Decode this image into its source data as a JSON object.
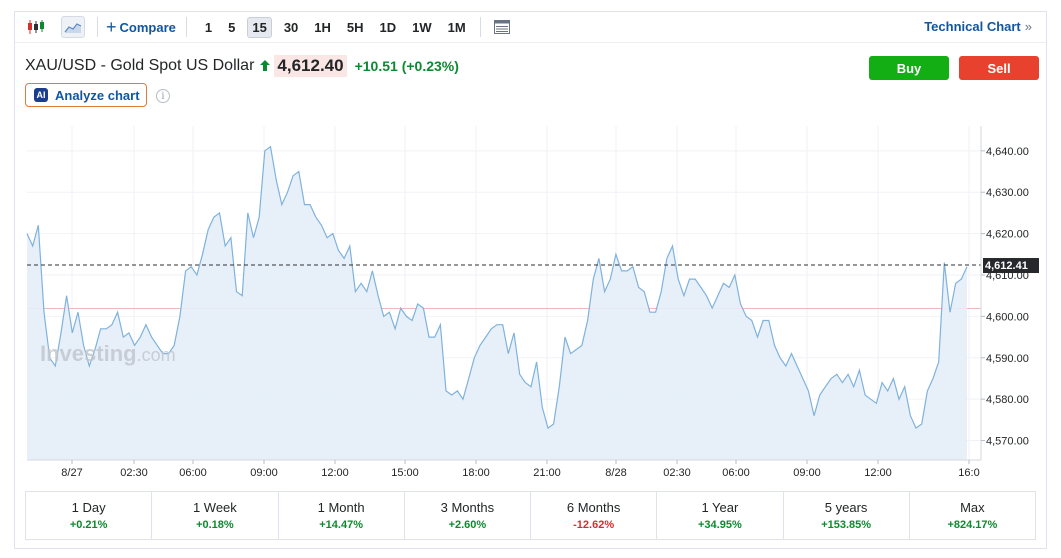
{
  "toolbar": {
    "compare_label": "Compare",
    "intervals": [
      "1",
      "5",
      "15",
      "30",
      "1H",
      "5H",
      "1D",
      "1W",
      "1M"
    ],
    "active_interval": "15",
    "technical_chart_label": "Technical Chart",
    "technical_chart_chevron": "»"
  },
  "instrument": {
    "name": "XAU/USD - Gold Spot US Dollar",
    "price": "4,612.40",
    "change": "+10.51",
    "change_pct": "(+0.23%)"
  },
  "buttons": {
    "buy": "Buy",
    "sell": "Sell"
  },
  "analyze": {
    "badge": "AI",
    "label": "Analyze chart"
  },
  "watermark": {
    "brand": "Investing",
    "suffix": ".com"
  },
  "colors": {
    "up": "#0d8a2f",
    "down": "#d32f2f",
    "buy": "#13ae13",
    "sell": "#e8412d",
    "line": "#7fb2dc",
    "area": "#e4eef7",
    "ref_line": "#f2b8b8"
  },
  "chart_data": {
    "type": "area",
    "x_tick_labels": [
      "8/27",
      "02:30",
      "06:00",
      "09:00",
      "12:00",
      "15:00",
      "18:00",
      "21:00",
      "8/28",
      "02:30",
      "06:00",
      "09:00",
      "12:00",
      "16:0"
    ],
    "y_tick_labels": [
      "4,640.00",
      "4,630.00",
      "4,620.00",
      "4,610.00",
      "4,600.00",
      "4,590.00",
      "4,580.00",
      "4,570.00"
    ],
    "y_ticks": [
      4640,
      4630,
      4620,
      4610,
      4600,
      4590,
      4580,
      4570
    ],
    "ylim": [
      4565.3,
      4646
    ],
    "last_price_label": "4,612.41",
    "last_price": 4612.41,
    "reference_price": 4601.9,
    "values": [
      4620.0,
      4617.0,
      4622.0,
      4601.0,
      4590.0,
      4588.0,
      4596.0,
      4605.0,
      4596.0,
      4601.0,
      4593.0,
      4588.0,
      4592.0,
      4597.0,
      4597.0,
      4598.0,
      4601.0,
      4595.0,
      4596.0,
      4593.0,
      4595.0,
      4598.0,
      4595.0,
      4593.0,
      4591.0,
      4591.0,
      4593.0,
      4600.0,
      4611.0,
      4612.0,
      4610.0,
      4615.0,
      4621.0,
      4624.0,
      4625.0,
      4617.0,
      4619.0,
      4606.0,
      4605.0,
      4625.0,
      4619.0,
      4624.0,
      4640.0,
      4641.0,
      4633.0,
      4627.0,
      4630.0,
      4634.0,
      4635.0,
      4627.0,
      4627.0,
      4624.0,
      4622.0,
      4619.0,
      4620.0,
      4616.0,
      4614.0,
      4617.0,
      4606.0,
      4608.0,
      4606.0,
      4611.0,
      4605.0,
      4600.0,
      4601.0,
      4597.0,
      4602.0,
      4600.0,
      4599.0,
      4603.0,
      4602.0,
      4595.0,
      4595.0,
      4598.0,
      4582.0,
      4581.0,
      4582.0,
      4580.0,
      4585.0,
      4590.0,
      4593.0,
      4595.0,
      4597.0,
      4598.0,
      4598.0,
      4591.0,
      4596.0,
      4586.0,
      4584.0,
      4583.0,
      4589.0,
      4578.0,
      4573.0,
      4574.0,
      4583.0,
      4595.0,
      4591.0,
      4592.0,
      4593.0,
      4599.0,
      4609.0,
      4614.0,
      4606.0,
      4609.0,
      4615.0,
      4611.0,
      4611.0,
      4612.0,
      4607.0,
      4606.0,
      4601.0,
      4601.0,
      4606.0,
      4614.0,
      4617.0,
      4609.0,
      4605.0,
      4609.0,
      4609.0,
      4607.0,
      4605.0,
      4602.0,
      4605.0,
      4608.0,
      4607.0,
      4610.0,
      4603.0,
      4600.0,
      4599.0,
      4595.0,
      4599.0,
      4599.0,
      4593.0,
      4590.0,
      4588.0,
      4591.0,
      4588.0,
      4585.0,
      4582.0,
      4576.0,
      4581.0,
      4583.0,
      4585.0,
      4586.0,
      4584.0,
      4586.0,
      4583.0,
      4587.0,
      4581.0,
      4580.0,
      4579.0,
      4584.0,
      4582.0,
      4585.0,
      4580.0,
      4583.0,
      4576.0,
      4573.0,
      4574.0,
      4582.0,
      4585.0,
      4589.0,
      4613.0,
      4601.0,
      4608.0,
      4609.0,
      4612.0
    ]
  },
  "performance": [
    {
      "label": "1 Day",
      "value": "+0.21%",
      "dir": "up"
    },
    {
      "label": "1 Week",
      "value": "+0.18%",
      "dir": "up"
    },
    {
      "label": "1 Month",
      "value": "+14.47%",
      "dir": "up"
    },
    {
      "label": "3 Months",
      "value": "+2.60%",
      "dir": "up"
    },
    {
      "label": "6 Months",
      "value": "-12.62%",
      "dir": "down"
    },
    {
      "label": "1 Year",
      "value": "+34.95%",
      "dir": "up"
    },
    {
      "label": "5 years",
      "value": "+153.85%",
      "dir": "up"
    },
    {
      "label": "Max",
      "value": "+824.17%",
      "dir": "up"
    }
  ]
}
